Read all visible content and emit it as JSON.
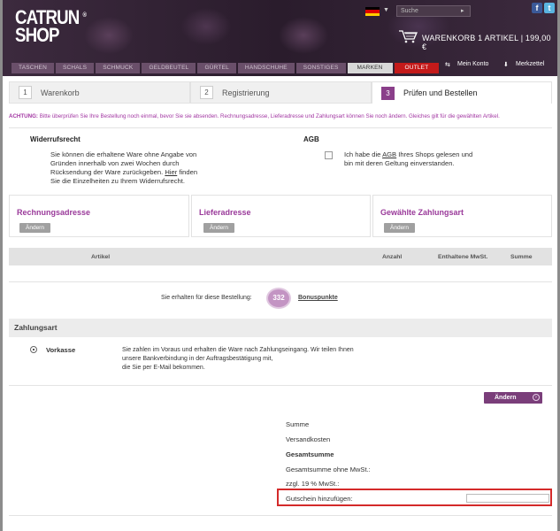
{
  "header": {
    "logo_top": "CATRUN",
    "logo_bottom": "SHOP",
    "logo_mark": "®",
    "search_placeholder": "Suche",
    "facebook": "f",
    "twitter": "t",
    "cart_text": "WARENKORB 1 ARTIKEL | 199,00 €",
    "nav": [
      "TASCHEN",
      "SCHALS",
      "SCHMUCK",
      "GELDBEUTEL",
      "GÜRTEL",
      "HANDSCHUHE",
      "SONSTIGES",
      "MARKEN",
      "OUTLET"
    ],
    "account": "Mein Konto",
    "wishlist": "Merkzettel"
  },
  "steps": [
    {
      "num": "1",
      "label": "Warenkorb"
    },
    {
      "num": "2",
      "label": "Registrierung"
    },
    {
      "num": "3",
      "label": "Prüfen und Bestellen"
    }
  ],
  "notice": {
    "bold": "ACHTUNG:",
    "text": " Bitte überprüfen Sie Ihre Bestellung noch einmal, bevor Sie sie absenden. Rechnungsadresse, Lieferadresse und Zahlungsart können Sie noch ändern. Gleiches gilt für die gewählten Artikel."
  },
  "widerruf": {
    "title": "Widerrufsrecht",
    "line1": "Sie können die erhaltene Ware ohne Angabe von",
    "line2": "Gründen innerhalb von zwei Wochen durch",
    "line3_pre": "Rücksendung der Ware zurückgeben. ",
    "line3_link": "Hier",
    "line3_post": " finden",
    "line4": "Sie die Einzelheiten zu Ihrem Widerrufsrecht."
  },
  "agb": {
    "title": "AGB",
    "line1_pre": "Ich habe die ",
    "line1_link": "AGB",
    "line1_post": " Ihres Shops gelesen und",
    "line2": "bin mit deren Geltung einverstanden."
  },
  "boxes": [
    {
      "title": "Rechnungsadresse",
      "button": "Ändern"
    },
    {
      "title": "Lieferadresse",
      "button": "Ändern"
    },
    {
      "title": "Gewählte Zahlungsart",
      "button": "Ändern"
    }
  ],
  "table": {
    "columns": [
      "Artikel",
      "Anzahl",
      "Enthaltene MwSt.",
      "Summe"
    ]
  },
  "bonus": {
    "prefix": "Sie erhalten für diese Bestellung:",
    "points": "332",
    "label": "Bonuspunkte"
  },
  "payment": {
    "heading": "Zahlungsart",
    "method": "Vorkasse",
    "desc1": "Sie zahlen im Voraus und erhalten die Ware nach Zahlungseingang. Wir teilen Ihnen",
    "desc2": "unsere Bankverbindung in der Auftragsbestätigung mit,",
    "desc3": "die Sie per E-Mail bekommen.",
    "change_button": "Ändern"
  },
  "summary": {
    "summe": "Summe",
    "versand": "Versandkosten",
    "gesamt": "Gesamtsumme",
    "ohne_mwst": "Gesamtsumme ohne MwSt.:",
    "mwst": "zzgl. 19 % MwSt.:",
    "voucher_label": "Gutschein hinzufügen:",
    "voucher_value": ""
  },
  "colors": {
    "accent": "#8a3f8a",
    "notice": "#a236a2",
    "voucher_border": "#d42a2a",
    "outlet": "#c41a1a"
  }
}
